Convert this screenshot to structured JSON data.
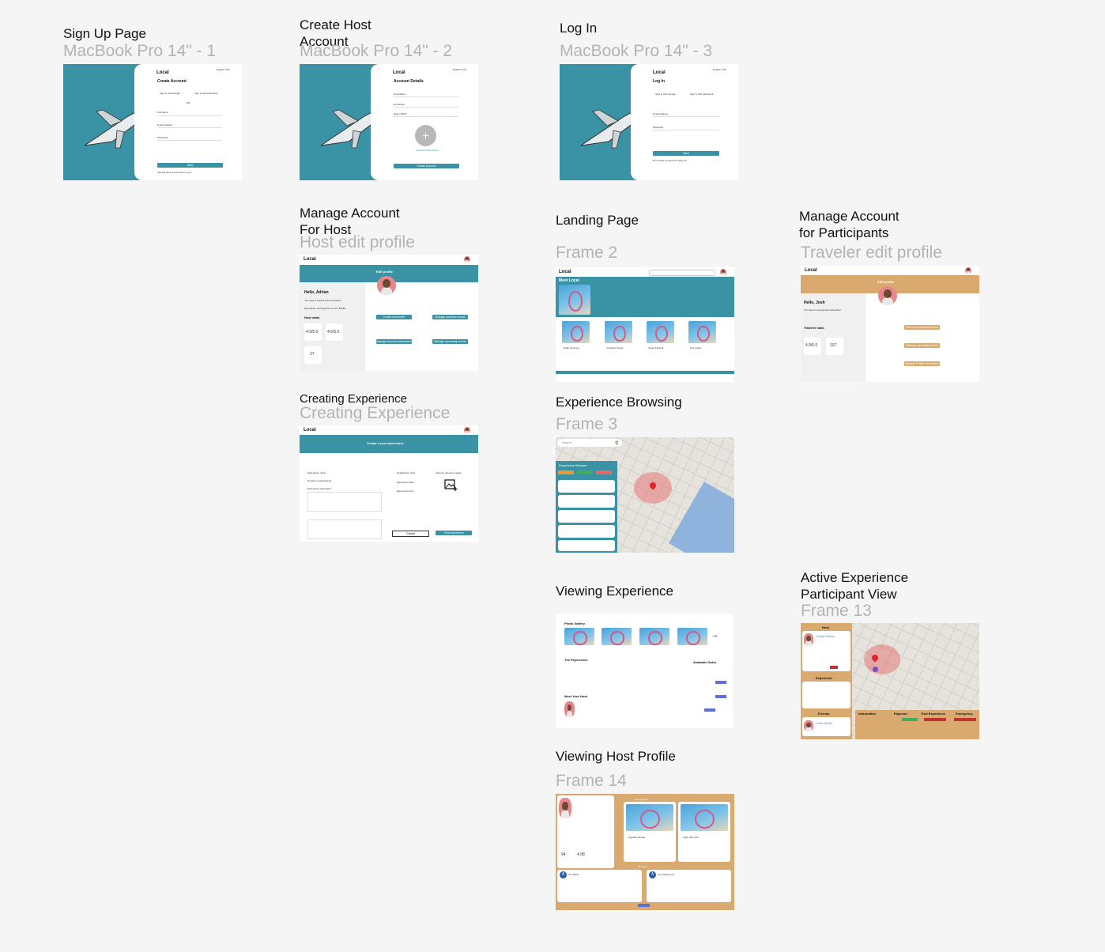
{
  "frames": {
    "signup": {
      "title": "Sign Up Page",
      "subtitle": "MacBook Pro 14\" - 1"
    },
    "host_account": {
      "title_line1": "Create Host",
      "title_line2": "Account",
      "subtitle": "MacBook Pro 14\" - 2"
    },
    "login": {
      "title": "Log In",
      "subtitle": "MacBook Pro 14\" - 3"
    },
    "manage_host": {
      "title_line1": "Manage Account",
      "title_line2": "For Host",
      "subtitle": "Host edit profile"
    },
    "landing": {
      "title": "Landing Page",
      "subtitle": "Frame 2"
    },
    "manage_participant": {
      "title_line1": "Manage Account",
      "title_line2": "for Participants",
      "subtitle": "Traveler edit profile"
    },
    "creating": {
      "title": "Creating Experience",
      "subtitle": "Creating Experience"
    },
    "browsing": {
      "title": "Experience Browsing",
      "subtitle": "Frame 3"
    },
    "viewing": {
      "title": "Viewing Experience"
    },
    "active": {
      "title_line1": "Active Experience",
      "title_line2": "Participant View",
      "subtitle": "Frame 13"
    },
    "host_profile": {
      "title": "Viewing Host Profile",
      "subtitle": "Frame 14"
    }
  },
  "mock": {
    "logo": "Local",
    "lang": "English (US)",
    "signup": {
      "heading": "Create Account",
      "google": "Sign in with Google",
      "facebook": "Sign in with Facebook",
      "or": "- OR -",
      "full_name": "Full Name",
      "email": "Email Address",
      "password": "Password",
      "submit": "Next",
      "footer": "Already have an account? Log in"
    },
    "host": {
      "heading": "Account Details",
      "f1": "Description",
      "f2": "Hometown",
      "f3": "Date of Birth",
      "upload": "Upload Profile Picture",
      "submit": "Create Account"
    },
    "login": {
      "heading": "Log In",
      "email": "Email Address",
      "password": "Password",
      "submit": "Next",
      "footer": "Don't have an account? Sign Up"
    },
    "manage_host": {
      "banner": "Edit profile",
      "hello": "Hello, Adrian",
      "line1": "You have 3 experiences scheduled",
      "line2": "Experience earnings this month: $1280",
      "stats": "Host stats",
      "rating": "4.9/5.0",
      "rating2": "4.6/5.0",
      "count": "27",
      "b1": "Create new event",
      "b2": "Manage previous events",
      "b3": "Manage Account Information",
      "b4": "Manage upcoming events"
    },
    "landing": {
      "title": "Meet Local",
      "cards": [
        "Night Jamming",
        "Campfire Songs",
        "Street Festival",
        "City Lights"
      ]
    },
    "participant": {
      "banner": "Edit profile",
      "hello": "Hello, Josh",
      "line1": "You have 2 experiences scheduled",
      "stats": "Traveler stats",
      "rating": "4.9/5.0",
      "count": "107",
      "b1": "View previous experiences",
      "b2": "Manage upcoming events",
      "b3": "Manage Profile Information"
    },
    "creating": {
      "banner": "Create a new experience",
      "name": "Experience name",
      "participants": "Number of participants",
      "description": "Experience description",
      "price": "Registration price",
      "date": "Experience date",
      "time": "Experience time",
      "images": "Add any relevant images",
      "cancel": "Cancel",
      "post": "Post experience"
    },
    "browsing": {
      "search": "Search",
      "panel": "Experience Browser"
    },
    "viewing": {
      "gallery": "Photo Gallery",
      "exp": "The Experience",
      "dates": "Available Dates",
      "host": "Meet Your Host"
    },
    "active": {
      "host": "Host",
      "name": "Emily Nelson",
      "exp": "Experience",
      "friends": "Friends",
      "friend": "Chris Smith",
      "info": "Information",
      "payment": "Payment",
      "end": "End Experience",
      "emergency": "Emergency"
    },
    "host_profile": {
      "upcoming": "Host Events",
      "reviews": "Reviews",
      "count": "94",
      "rating": "4.98",
      "card1": "Nightlife Parade",
      "card2": "Night with Kids",
      "reviewer1": "Tim White",
      "reviewer2": "Cory Nakamura"
    }
  }
}
